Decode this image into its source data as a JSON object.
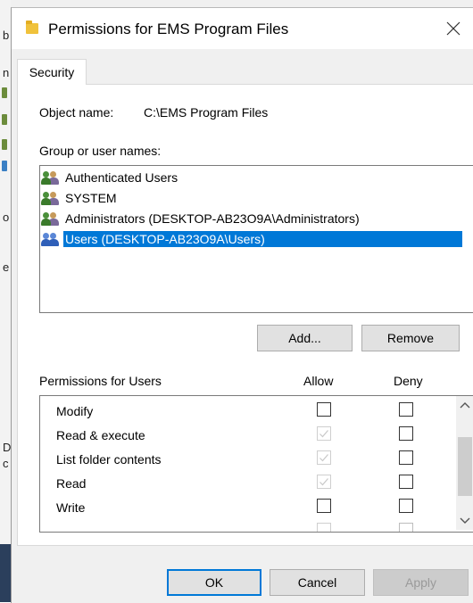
{
  "dialog": {
    "title": "Permissions for EMS Program Files",
    "close_glyph": "✕",
    "tab_label": "Security",
    "object_name_label": "Object name:",
    "object_name_value": "C:\\EMS Program Files",
    "group_label": "Group or user names:",
    "users": [
      {
        "name": "Authenticated Users",
        "selected": false
      },
      {
        "name": "SYSTEM",
        "selected": false
      },
      {
        "name": "Administrators (DESKTOP-AB23O9A\\Administrators)",
        "selected": false
      },
      {
        "name": "Users (DESKTOP-AB23O9A\\Users)",
        "selected": true
      }
    ],
    "add_label": "Add...",
    "remove_label": "Remove",
    "permissions_label": "Permissions for Users",
    "allow_header": "Allow",
    "deny_header": "Deny",
    "permissions": [
      {
        "name": "Modify",
        "allow": false,
        "allow_disabled": false,
        "deny": false
      },
      {
        "name": "Read & execute",
        "allow": true,
        "allow_disabled": true,
        "deny": false
      },
      {
        "name": "List folder contents",
        "allow": true,
        "allow_disabled": true,
        "deny": false
      },
      {
        "name": "Read",
        "allow": true,
        "allow_disabled": true,
        "deny": false
      },
      {
        "name": "Write",
        "allow": false,
        "allow_disabled": false,
        "deny": false
      }
    ],
    "ok_label": "OK",
    "cancel_label": "Cancel",
    "apply_label": "Apply"
  },
  "background": {
    "edge_chars": [
      "b",
      "n",
      "o",
      "e",
      "D",
      "c"
    ]
  },
  "colors": {
    "selection": "#0078d7",
    "dialog_bg": "#f0f0f0"
  }
}
